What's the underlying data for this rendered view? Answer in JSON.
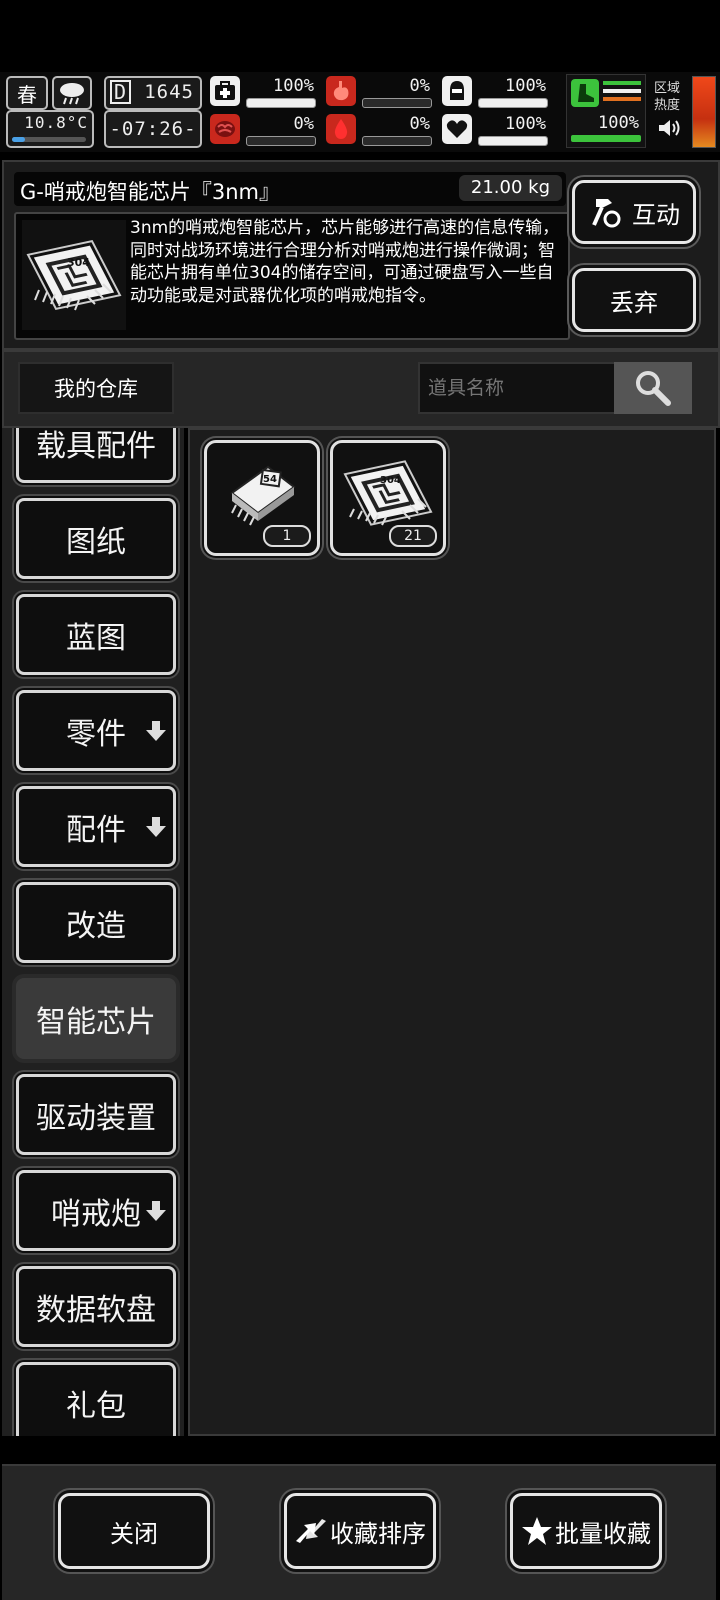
{
  "status": {
    "season": "春",
    "temperature": "10.8°C",
    "day_counter": "1645",
    "time": "-07:26-",
    "health_pct": "100%",
    "hunger_pct": "0%",
    "armor_pct": "100%",
    "sanity_pct": "0%",
    "bleed_pct": "0%",
    "mood_pct": "100%",
    "stamina_pct": "100%",
    "zone_heat_label": "区域热度",
    "bars": {
      "health": 1.0,
      "hunger": 0.0,
      "armor": 1.0,
      "sanity": 0.0,
      "bleed": 0.0,
      "mood": 1.0,
      "stamina": 1.0
    }
  },
  "item": {
    "name": "G-哨戒炮智能芯片『3nm』",
    "weight": "21.00 kg",
    "description": "3nm的哨戒炮智能芯片，芯片能够进行高速的信息传输，同时对战场环境进行合理分析对哨戒炮进行操作微调；智能芯片拥有单位304的储存空间，可通过硬盘写入一些自动功能或是对武器优化项的哨戒炮指令。",
    "chip_label": "304",
    "interact_label": "互动",
    "discard_label": "丢弃"
  },
  "storage": {
    "title": "我的仓库",
    "search_placeholder": "道具名称"
  },
  "categories": [
    {
      "label": "载具配件"
    },
    {
      "label": "图纸"
    },
    {
      "label": "蓝图"
    },
    {
      "label": "零件"
    },
    {
      "label": "配件"
    },
    {
      "label": "改造"
    },
    {
      "label": "智能芯片"
    },
    {
      "label": "驱动装置"
    },
    {
      "label": "哨戒炮"
    },
    {
      "label": "数据软盘"
    },
    {
      "label": "礼包"
    }
  ],
  "slots": [
    {
      "chip_label": "54",
      "count": "1"
    },
    {
      "chip_label": "304",
      "count": "21"
    }
  ],
  "bottom": {
    "close": "关闭",
    "sort": "收藏排序",
    "batch": "批量收藏"
  },
  "colors": {
    "accent_red": "#c9281d",
    "stamina_green": "#3cc33c",
    "heat_orange": "#e05a1a"
  }
}
